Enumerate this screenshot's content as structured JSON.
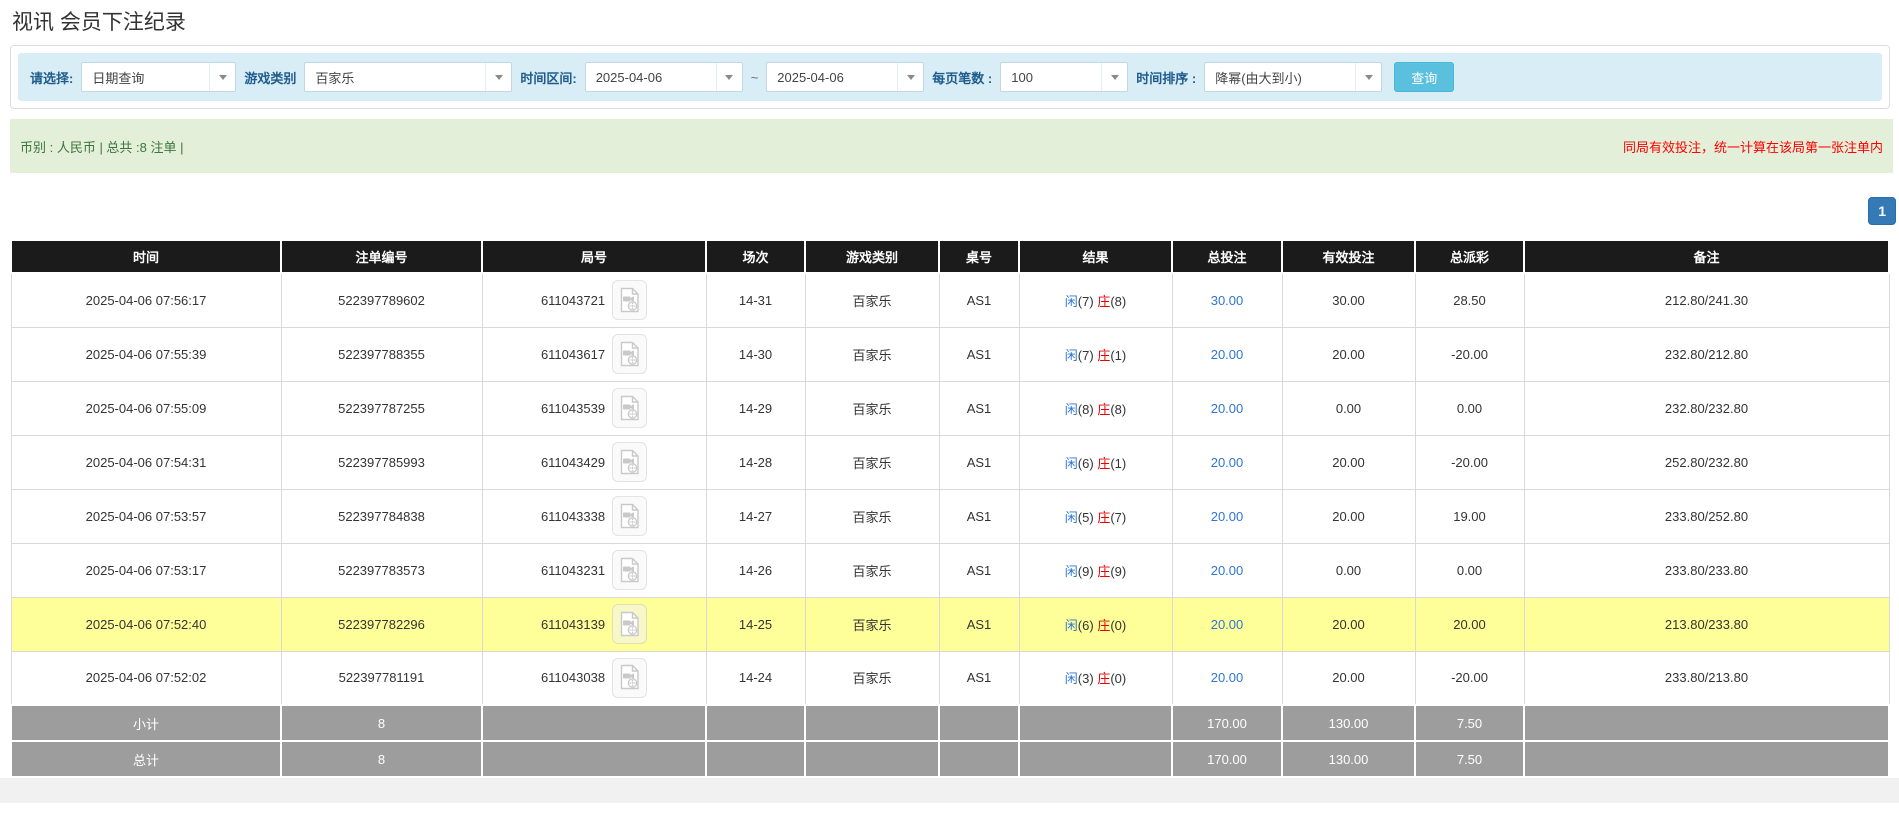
{
  "page": {
    "title": "视讯 会员下注纪录"
  },
  "filters": {
    "select_label": "请选择:",
    "select_value": "日期查询",
    "game_type_label": "游戏类别",
    "game_type_value": "百家乐",
    "time_range_label": "时间区间:",
    "date_from": "2025-04-06",
    "tilde": "~",
    "date_to": "2025-04-06",
    "page_size_label": "每页笔数 :",
    "page_size_value": "100",
    "sort_label": "时间排序 :",
    "sort_value": "降幂(由大到小)",
    "search_button": "查询"
  },
  "summary_bar": {
    "left_text": "币别 : 人民币 | 总共 :8 注单 |",
    "right_text": "同局有效投注，统一计算在该局第一张注单内"
  },
  "pagination": {
    "current_page": "1"
  },
  "icons": {
    "dropdown": "chevron-down",
    "round_video": "video-file"
  },
  "colors": {
    "filter_bar_bg": "#d9edf7",
    "filter_label": "#1f5c8b",
    "search_button_bg": "#5bc0de",
    "summary_bar_bg": "#e3efd8",
    "summary_left_text": "#3c763d",
    "summary_right_text": "#ff0000",
    "pagination_bg": "#337ab7",
    "table_header_bg": "#1b1b1b",
    "highlight_row_bg": "#ffff99",
    "summary_row_bg": "#9d9d9d",
    "player_blue": "#2e75d4",
    "banker_red": "#e60000",
    "negative_red": "#ff0000",
    "bet_link_blue": "#2e75d4"
  },
  "table": {
    "headers": [
      "时间",
      "注单编号",
      "局号",
      "场次",
      "游戏类别",
      "桌号",
      "结果",
      "总投注",
      "有效投注",
      "总派彩",
      "备注"
    ],
    "rows": [
      {
        "time": "2025-04-06 07:56:17",
        "bet_id": "522397789602",
        "round_id": "611043721",
        "session": "14-31",
        "game": "百家乐",
        "table_id": "AS1",
        "p_label": "闲",
        "p_val": "(7)",
        "b_label": "庄",
        "b_val": "(8)",
        "total_bet": "30.00",
        "valid_bet": "30.00",
        "payout": "28.50",
        "remark": "212.80/241.30",
        "highlighted": false
      },
      {
        "time": "2025-04-06 07:55:39",
        "bet_id": "522397788355",
        "round_id": "611043617",
        "session": "14-30",
        "game": "百家乐",
        "table_id": "AS1",
        "p_label": "闲",
        "p_val": "(7)",
        "b_label": "庄",
        "b_val": "(1)",
        "total_bet": "20.00",
        "valid_bet": "20.00",
        "payout": "-20.00",
        "remark": "232.80/212.80",
        "highlighted": false
      },
      {
        "time": "2025-04-06 07:55:09",
        "bet_id": "522397787255",
        "round_id": "611043539",
        "session": "14-29",
        "game": "百家乐",
        "table_id": "AS1",
        "p_label": "闲",
        "p_val": "(8)",
        "b_label": "庄",
        "b_val": "(8)",
        "total_bet": "20.00",
        "valid_bet": "0.00",
        "payout": "0.00",
        "remark": "232.80/232.80",
        "highlighted": false
      },
      {
        "time": "2025-04-06 07:54:31",
        "bet_id": "522397785993",
        "round_id": "611043429",
        "session": "14-28",
        "game": "百家乐",
        "table_id": "AS1",
        "p_label": "闲",
        "p_val": "(6)",
        "b_label": "庄",
        "b_val": "(1)",
        "total_bet": "20.00",
        "valid_bet": "20.00",
        "payout": "-20.00",
        "remark": "252.80/232.80",
        "highlighted": false
      },
      {
        "time": "2025-04-06 07:53:57",
        "bet_id": "522397784838",
        "round_id": "611043338",
        "session": "14-27",
        "game": "百家乐",
        "table_id": "AS1",
        "p_label": "闲",
        "p_val": "(5)",
        "b_label": "庄",
        "b_val": "(7)",
        "total_bet": "20.00",
        "valid_bet": "20.00",
        "payout": "19.00",
        "remark": "233.80/252.80",
        "highlighted": false
      },
      {
        "time": "2025-04-06 07:53:17",
        "bet_id": "522397783573",
        "round_id": "611043231",
        "session": "14-26",
        "game": "百家乐",
        "table_id": "AS1",
        "p_label": "闲",
        "p_val": "(9)",
        "b_label": "庄",
        "b_val": "(9)",
        "total_bet": "20.00",
        "valid_bet": "0.00",
        "payout": "0.00",
        "remark": "233.80/233.80",
        "highlighted": false
      },
      {
        "time": "2025-04-06 07:52:40",
        "bet_id": "522397782296",
        "round_id": "611043139",
        "session": "14-25",
        "game": "百家乐",
        "table_id": "AS1",
        "p_label": "闲",
        "p_val": "(6)",
        "b_label": "庄",
        "b_val": "(0)",
        "total_bet": "20.00",
        "valid_bet": "20.00",
        "payout": "20.00",
        "remark": "213.80/233.80",
        "highlighted": true
      },
      {
        "time": "2025-04-06 07:52:02",
        "bet_id": "522397781191",
        "round_id": "611043038",
        "session": "14-24",
        "game": "百家乐",
        "table_id": "AS1",
        "p_label": "闲",
        "p_val": "(3)",
        "b_label": "庄",
        "b_val": "(0)",
        "total_bet": "20.00",
        "valid_bet": "20.00",
        "payout": "-20.00",
        "remark": "233.80/213.80",
        "highlighted": false
      }
    ],
    "subtotal": {
      "label": "小计",
      "count": "8",
      "total_bet": "170.00",
      "valid_bet": "130.00",
      "payout": "7.50"
    },
    "total": {
      "label": "总计",
      "count": "8",
      "total_bet": "170.00",
      "valid_bet": "130.00",
      "payout": "7.50"
    }
  }
}
